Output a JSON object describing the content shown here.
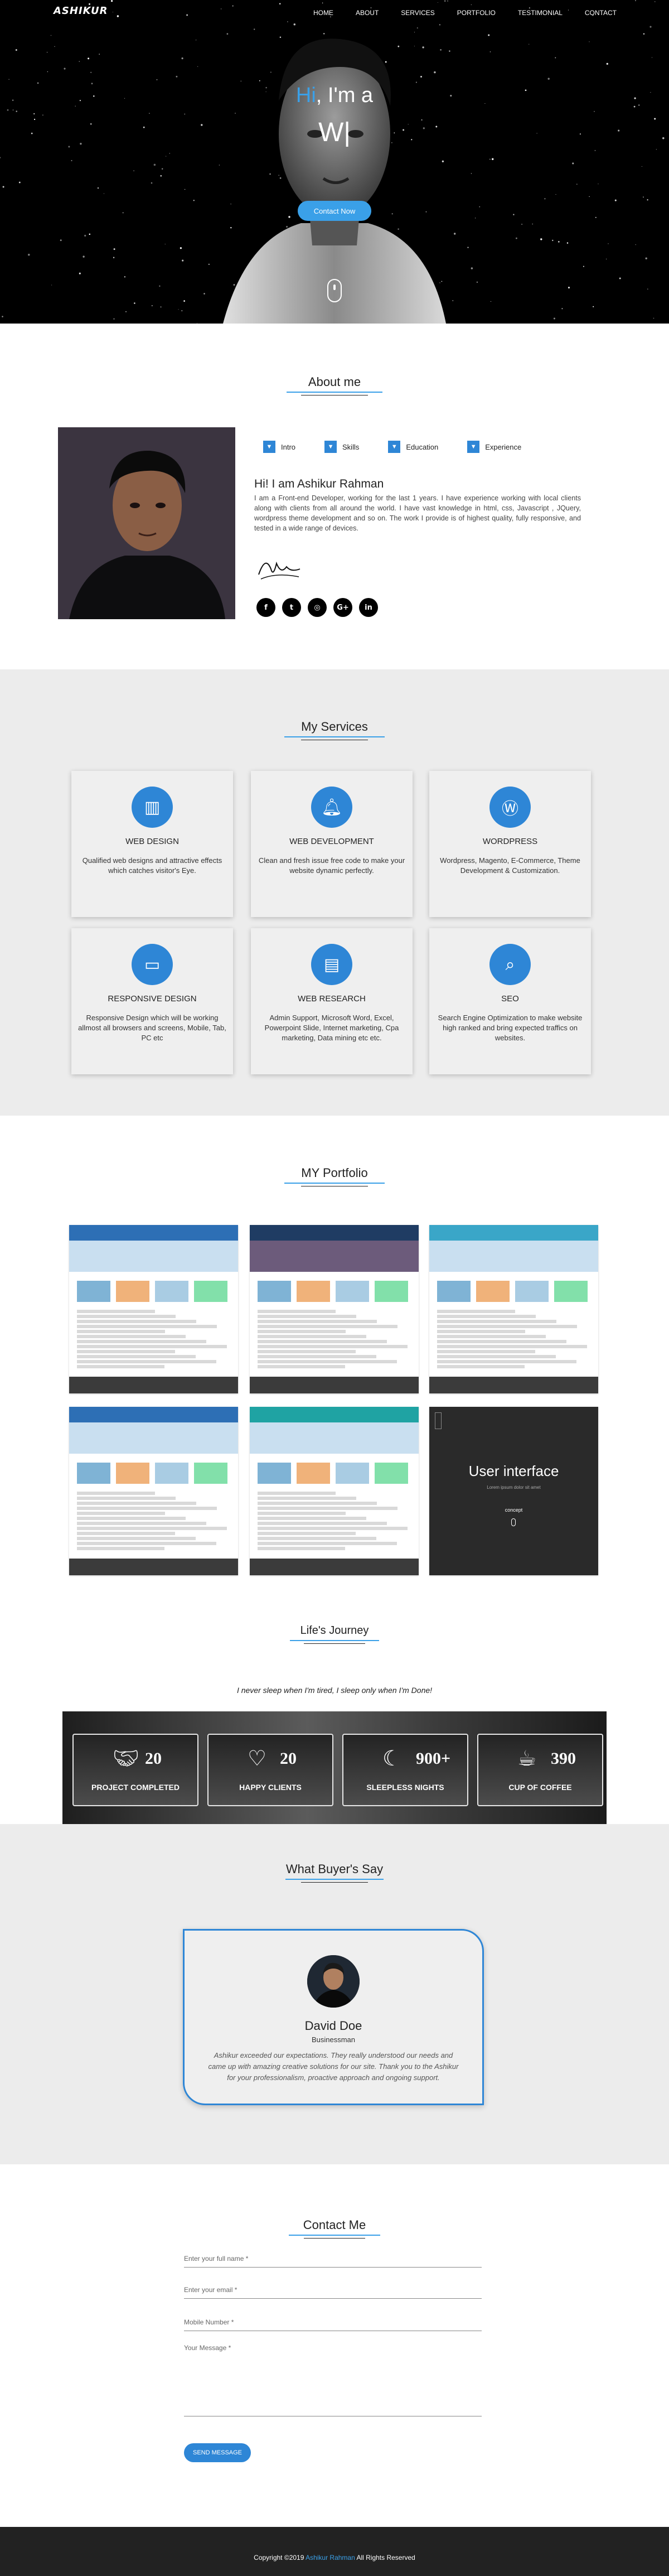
{
  "nav": {
    "logo": "ASHIKUR",
    "items": [
      "HOME",
      "ABOUT",
      "SERVICES",
      "PORTFOLIO",
      "TESTIMONIAL",
      "CONTACT"
    ]
  },
  "hero": {
    "greeting_hi": "Hi",
    "greeting_rest": ", I'm a",
    "typing_text": "W|",
    "cta_label": "Contact Now"
  },
  "about": {
    "title": "About me",
    "tabs": [
      "Intro",
      "Skills",
      "Education",
      "Experience"
    ],
    "heading": "Hi! I am Ashikur Rahman",
    "paragraph": "I am a Front-end Developer, working for the last 1 years. I have experience working with local clients along with clients from all around the world. I have vast knowledge in html, css, Javascript , JQuery, wordpress theme development and so on. The work I provide is of highest quality, fully responsive, and tested in a wide range of devices.",
    "socials": [
      {
        "icon": "facebook-icon",
        "glyph": "f"
      },
      {
        "icon": "twitter-icon",
        "glyph": "t"
      },
      {
        "icon": "instagram-icon",
        "glyph": "◎"
      },
      {
        "icon": "google-plus-icon",
        "glyph": "G+"
      },
      {
        "icon": "linkedin-icon",
        "glyph": "in"
      }
    ]
  },
  "services": {
    "title": "My Services",
    "items": [
      {
        "icon": "bar-chart-icon",
        "glyph": "▥",
        "title": "WEB DESIGN",
        "desc": "Qualified web designs and attractive effects which catches visitor's Eye."
      },
      {
        "icon": "bell-icon",
        "glyph": "🔔︎",
        "title": "WEB DEVELOPMENT",
        "desc": "Clean and fresh issue free code to make your website dynamic perfectly."
      },
      {
        "icon": "wordpress-icon",
        "glyph": "Ⓦ",
        "title": "WORDPRESS",
        "desc": "Wordpress, Magento, E-Commerce, Theme Development & Customization."
      },
      {
        "icon": "laptop-icon",
        "glyph": "▭",
        "title": "RESPONSIVE DESIGN",
        "desc": "Responsive Design which will be working allmost all browsers and screens, Mobile, Tab, PC etc"
      },
      {
        "icon": "document-icon",
        "glyph": "▤",
        "title": "WEB RESEARCH",
        "desc": "Admin Support, Microsoft Word, Excel, Powerpoint Slide, Internet marketing, Cpa marketing, Data mining etc etc."
      },
      {
        "icon": "search-icon",
        "glyph": "⌕",
        "title": "SEO",
        "desc": "Search Engine Optimization to make website high ranked and bring expected traffics on websites."
      }
    ]
  },
  "portfolio": {
    "title": "MY Portfolio",
    "ui_heading": "User interface",
    "ui_sub": "Lorem ipsum dolor sit amet",
    "ui_label": "concept",
    "accents": [
      "#2d6fb5",
      "#1f3c63",
      "#3aa6c8",
      "#2d6fb5",
      "#1fa3a3",
      "#2a2a2a"
    ]
  },
  "journey": {
    "title": "Life's Journey",
    "quote": "I never sleep when I'm tired, I sleep only when I'm Done!",
    "stats": [
      {
        "icon": "handshake-icon",
        "glyph": "🤝︎",
        "value": "20",
        "label": "PROJECT COMPLETED"
      },
      {
        "icon": "heart-icon",
        "glyph": "♡",
        "value": "20",
        "label": "HAPPY CLIENTS"
      },
      {
        "icon": "moon-icon",
        "glyph": "☾",
        "value": "900+",
        "label": "SLEEPLESS NIGHTS"
      },
      {
        "icon": "coffee-icon",
        "glyph": "☕︎",
        "value": "390",
        "label": "CUP OF COFFEE"
      }
    ]
  },
  "testimonial": {
    "title": "What Buyer's Say",
    "name": "David Doe",
    "role": "Businessman",
    "text": "Ashikur exceeded our expectations. They really understood our needs and came up with amazing creative solutions for our site. Thank you to the Ashikur for your professionalism, proactive approach and ongoing support."
  },
  "contact": {
    "title": "Contact Me",
    "name_placeholder": "Enter your full name *",
    "email_placeholder": "Enter your email *",
    "mobile_placeholder": "Mobile Number *",
    "message_placeholder": "Your Message *",
    "send_label": "SEND MESSAGE"
  },
  "footer": {
    "prefix": "Copyright ©2019",
    "name": "Ashikur Rahman",
    "suffix": "All Rights Reserved"
  },
  "colors": {
    "accent": "#3aa0e8",
    "primary_blue": "#2e86d6",
    "section_grey": "#ececec",
    "footer": "#222222"
  }
}
